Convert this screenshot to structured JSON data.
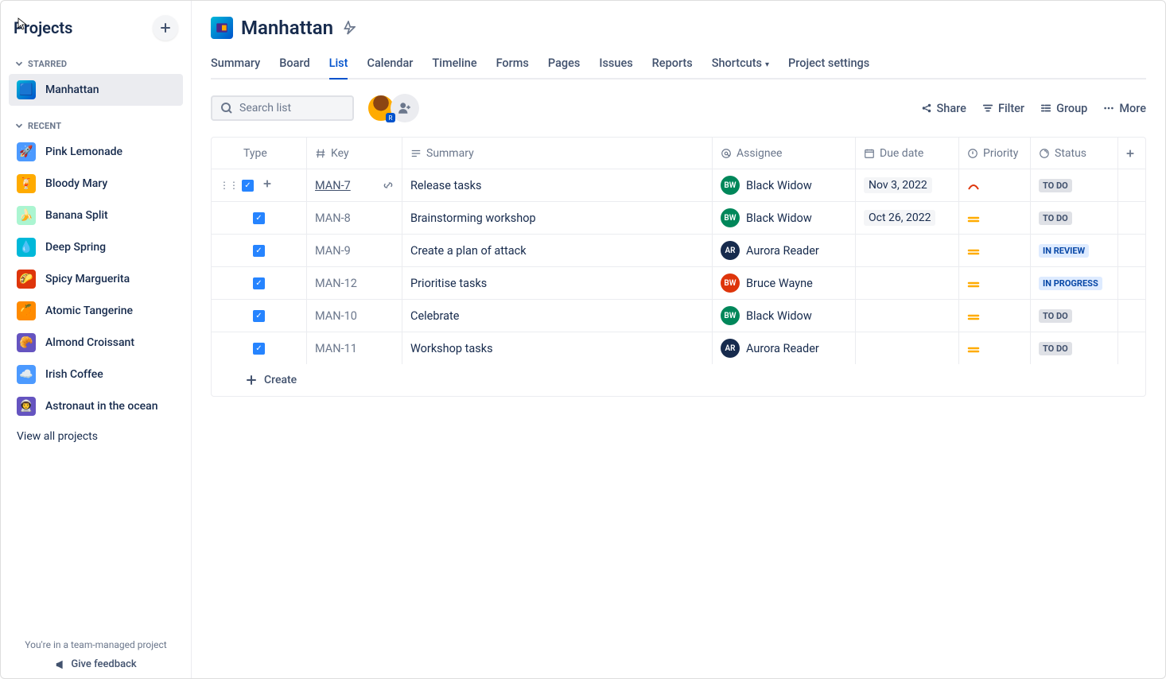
{
  "sidebar": {
    "title": "Projects",
    "sections": {
      "starred": {
        "label": "STARRED",
        "items": [
          {
            "label": "Manhattan"
          }
        ]
      },
      "recent": {
        "label": "RECENT",
        "items": [
          {
            "label": "Pink Lemonade"
          },
          {
            "label": "Bloody Mary"
          },
          {
            "label": "Banana Split"
          },
          {
            "label": "Deep Spring"
          },
          {
            "label": "Spicy Marguerita"
          },
          {
            "label": "Atomic Tangerine"
          },
          {
            "label": "Almond Croissant"
          },
          {
            "label": "Irish Coffee"
          },
          {
            "label": "Astronaut in the ocean"
          }
        ]
      }
    },
    "view_all": "View all projects",
    "footer_note": "You're in a team-managed project",
    "feedback": "Give feedback"
  },
  "project": {
    "title": "Manhattan",
    "tabs": [
      "Summary",
      "Board",
      "List",
      "Calendar",
      "Timeline",
      "Forms",
      "Pages",
      "Issues",
      "Reports",
      "Shortcuts",
      "Project settings"
    ],
    "active_tab": "List"
  },
  "toolbar": {
    "search_placeholder": "Search list",
    "share": "Share",
    "filter": "Filter",
    "group": "Group",
    "more": "More"
  },
  "table": {
    "columns": {
      "type": "Type",
      "key": "Key",
      "summary": "Summary",
      "assignee": "Assignee",
      "due": "Due date",
      "priority": "Priority",
      "status": "Status"
    },
    "rows": [
      {
        "key": "MAN-7",
        "summary": "Release tasks",
        "assignee": "Black Widow",
        "assignee_initials": "BW",
        "assignee_color": "green",
        "due": "Nov 3, 2022",
        "priority": "high",
        "status": "TO DO",
        "status_class": "todo",
        "hover": true
      },
      {
        "key": "MAN-8",
        "summary": "Brainstorming workshop",
        "assignee": "Black Widow",
        "assignee_initials": "BW",
        "assignee_color": "green",
        "due": "Oct 26, 2022",
        "priority": "medium",
        "status": "TO DO",
        "status_class": "todo"
      },
      {
        "key": "MAN-9",
        "summary": "Create a plan of attack",
        "assignee": "Aurora Reader",
        "assignee_initials": "AR",
        "assignee_color": "navy",
        "due": "",
        "priority": "medium",
        "status": "IN REVIEW",
        "status_class": "review"
      },
      {
        "key": "MAN-12",
        "summary": "Prioritise tasks",
        "assignee": "Bruce Wayne",
        "assignee_initials": "BW",
        "assignee_color": "red",
        "due": "",
        "priority": "medium",
        "status": "IN PROGRESS",
        "status_class": "progress"
      },
      {
        "key": "MAN-10",
        "summary": "Celebrate",
        "assignee": "Black Widow",
        "assignee_initials": "BW",
        "assignee_color": "green",
        "due": "",
        "priority": "medium",
        "status": "TO DO",
        "status_class": "todo"
      },
      {
        "key": "MAN-11",
        "summary": "Workshop tasks",
        "assignee": "Aurora Reader",
        "assignee_initials": "AR",
        "assignee_color": "navy",
        "due": "",
        "priority": "medium",
        "status": "TO DO",
        "status_class": "todo"
      }
    ],
    "create": "Create"
  }
}
